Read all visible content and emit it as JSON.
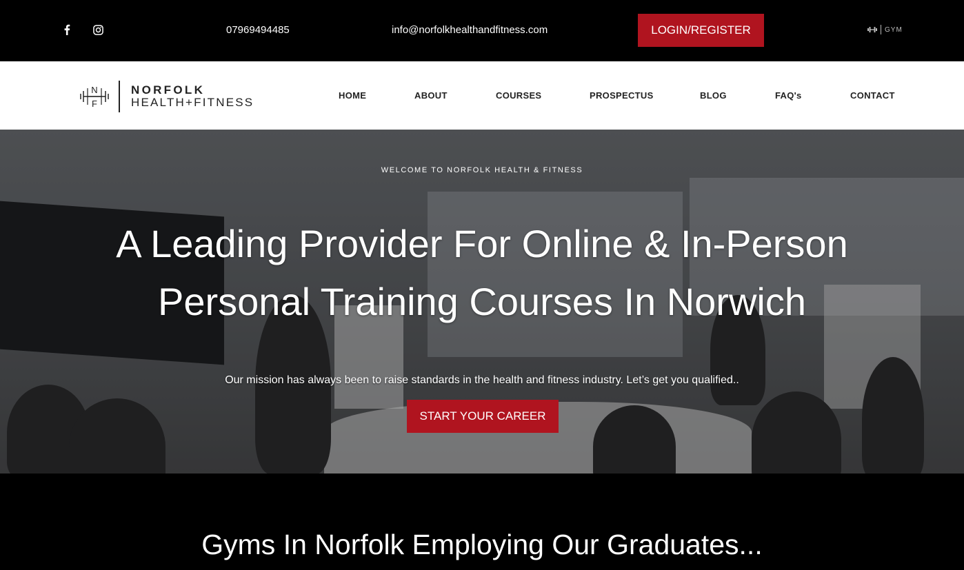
{
  "topbar": {
    "facebook_icon": "facebook-icon",
    "instagram_icon": "instagram-icon",
    "phone": "07969494485",
    "email": "info@norfolkhealthandfitness.com",
    "login_label": "LOGIN/REGISTER",
    "partner_logo_text": "GYM"
  },
  "brand": {
    "line1": "NORFOLK",
    "line2": "HEALTH+FITNESS"
  },
  "nav": {
    "items": [
      {
        "label": "HOME"
      },
      {
        "label": "ABOUT"
      },
      {
        "label": "COURSES"
      },
      {
        "label": "PROSPECTUS"
      },
      {
        "label": "BLOG"
      },
      {
        "label": "FAQ's"
      },
      {
        "label": "CONTACT"
      }
    ]
  },
  "hero": {
    "eyebrow": "WELCOME TO NORFOLK HEALTH & FITNESS",
    "title_line1": "A Leading Provider For Online & In-Person",
    "title_line2": "Personal Training Courses In Norwich",
    "subtitle": "Our mission has always been to raise standards in the health and fitness industry. Let’s get you qualified..",
    "cta_label": "START YOUR CAREER"
  },
  "section": {
    "title": "Gyms In Norfolk Employing Our Graduates..."
  },
  "colors": {
    "accent": "#b0141f",
    "topbar_bg": "#000000",
    "navbar_bg": "#ffffff"
  }
}
